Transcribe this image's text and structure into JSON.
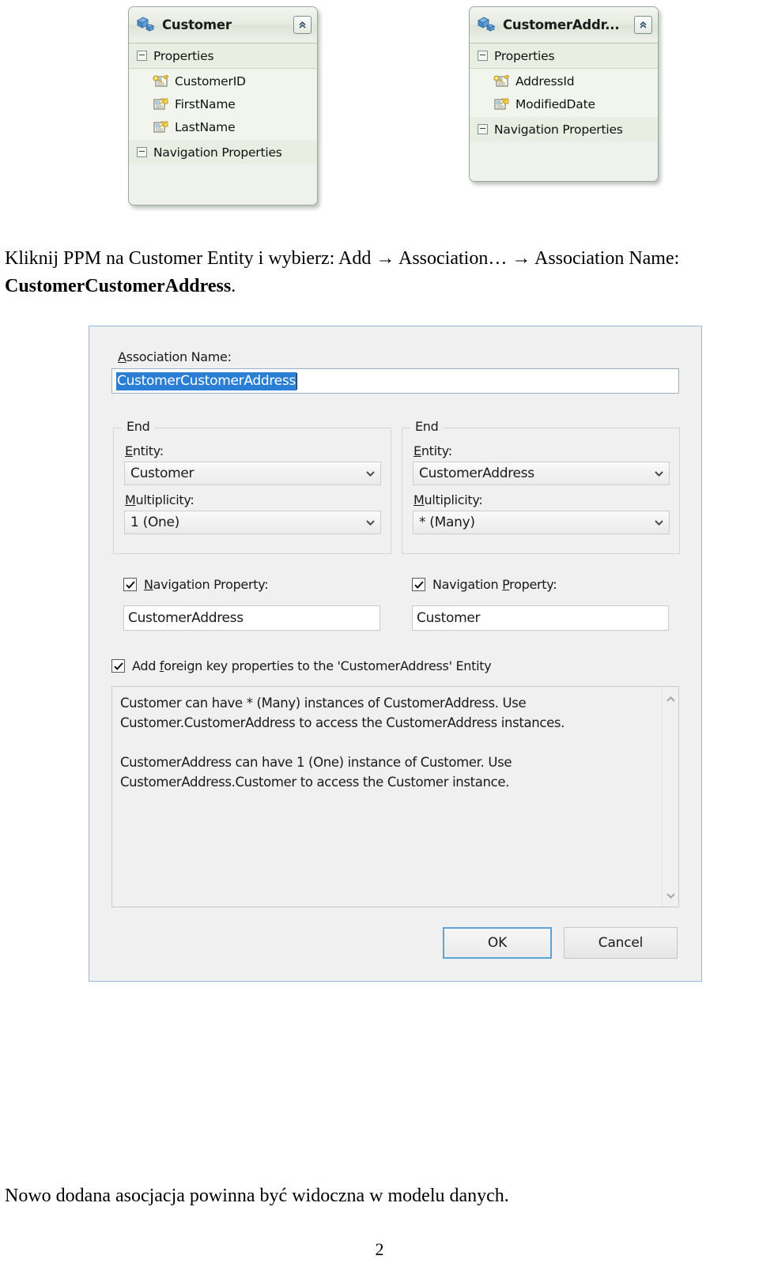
{
  "entities": [
    {
      "name": "entity-customer",
      "title": "Customer",
      "icon": "entity-icon",
      "collapse_icon": "chevron-double-up-icon",
      "properties_section": "Properties",
      "navigation_section": "Navigation Properties",
      "properties": [
        {
          "label": "CustomerID",
          "icon": "key-property-icon"
        },
        {
          "label": "FirstName",
          "icon": "scalar-property-icon"
        },
        {
          "label": "LastName",
          "icon": "scalar-property-icon"
        }
      ]
    },
    {
      "name": "entity-customeraddress",
      "title": "CustomerAddr...",
      "icon": "entity-icon",
      "collapse_icon": "chevron-double-up-icon",
      "properties_section": "Properties",
      "navigation_section": "Navigation Properties",
      "properties": [
        {
          "label": "AddressId",
          "icon": "key-property-icon"
        },
        {
          "label": "ModifiedDate",
          "icon": "scalar-property-icon"
        }
      ]
    }
  ],
  "instruction": {
    "line1": "Kliknij PPM na Customer Entity i wybierz: Add → Association… → Association Name:",
    "line2_bold": "CustomerCustomerAddress",
    "line2_tail": "."
  },
  "dialog": {
    "association_name_label": "Association Name:",
    "association_name_label_accel": "A",
    "association_name_label_rest": "ssociation Name:",
    "association_name_value": "CustomerCustomerAddress",
    "ends": [
      {
        "legend": "End",
        "entity_label_accel": "E",
        "entity_label_rest": "ntity:",
        "entity_value": "Customer",
        "multiplicity_label_accel": "M",
        "multiplicity_label_rest": "ultiplicity:",
        "multiplicity_value": "1 (One)",
        "nav_label_pre": "",
        "nav_label_accel": "N",
        "nav_label_rest": "avigation Property:",
        "nav_checked": true,
        "nav_value": "CustomerAddress",
        "dropdown_icon": "chevron-down-icon"
      },
      {
        "legend": "End",
        "entity_label_accel": "E",
        "entity_label_rest": "ntity:",
        "entity_value": "CustomerAddress",
        "multiplicity_label_accel": "M",
        "multiplicity_label_rest": "ultiplicity:",
        "multiplicity_value": "* (Many)",
        "nav_label_pre": "Navigation ",
        "nav_label_accel": "P",
        "nav_label_rest": "roperty:",
        "nav_checked": true,
        "nav_value": "Customer",
        "dropdown_icon": "chevron-down-icon"
      }
    ],
    "fk_checkbox": {
      "checked": true,
      "label_pre": "Add ",
      "label_accel": "f",
      "label_rest": "oreign key properties to the 'CustomerAddress' Entity"
    },
    "description": "Customer can have * (Many) instances of CustomerAddress. Use\nCustomer.CustomerAddress to access the CustomerAddress instances.\n\nCustomerAddress can have 1 (One) instance of Customer. Use\nCustomerAddress.Customer to access the Customer instance.",
    "scrollbar": {
      "up_icon": "chevron-up-icon",
      "down_icon": "chevron-down-icon"
    },
    "ok_label": "OK",
    "cancel_label": "Cancel"
  },
  "footer": {
    "text": "Nowo dodana asocjacja powinna być widoczna w modelu danych.",
    "page_number": "2"
  },
  "colors": {
    "selection_blue": "#2a7fd4",
    "dialog_border": "#9ab6d4",
    "default_button_border": "#5ba3d8",
    "entity_bg": "#eff2ec"
  }
}
